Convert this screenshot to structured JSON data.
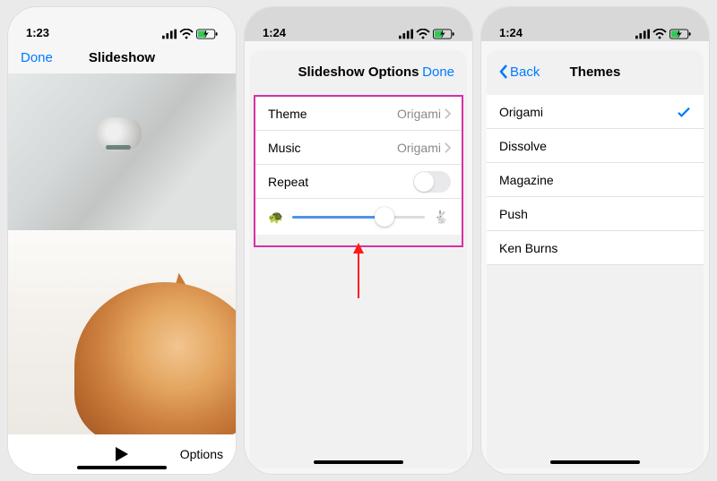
{
  "screens": {
    "s1": {
      "time": "1:23",
      "done": "Done",
      "title": "Slideshow",
      "options": "Options"
    },
    "s2": {
      "time": "1:24",
      "title": "Slideshow Options",
      "done": "Done",
      "rows": {
        "theme": {
          "label": "Theme",
          "value": "Origami"
        },
        "music": {
          "label": "Music",
          "value": "Origami"
        },
        "repeat": {
          "label": "Repeat",
          "on": false
        }
      },
      "slider_pct": 70
    },
    "s3": {
      "time": "1:24",
      "back": "Back",
      "title": "Themes",
      "items": [
        {
          "label": "Origami",
          "selected": true
        },
        {
          "label": "Dissolve",
          "selected": false
        },
        {
          "label": "Magazine",
          "selected": false
        },
        {
          "label": "Push",
          "selected": false
        },
        {
          "label": "Ken Burns",
          "selected": false
        }
      ]
    }
  }
}
